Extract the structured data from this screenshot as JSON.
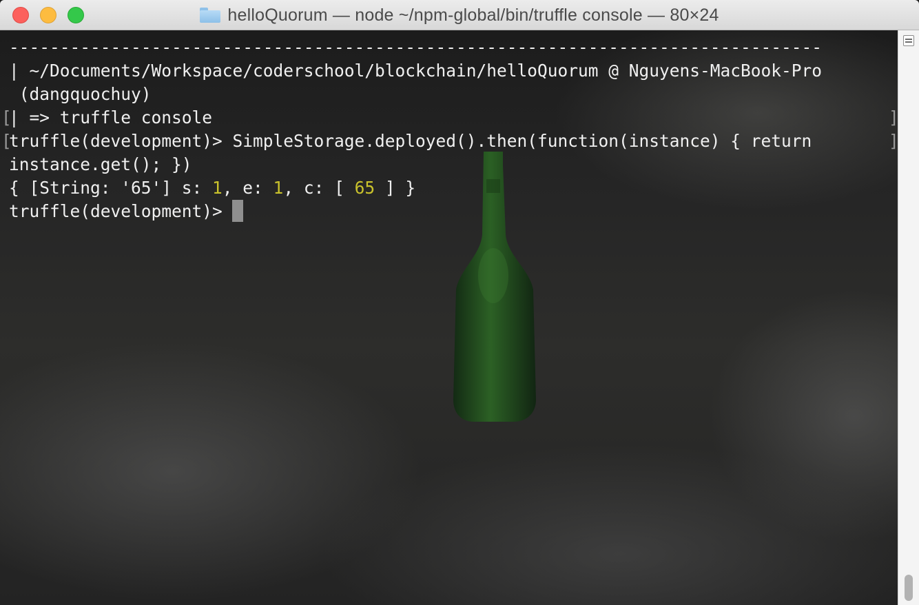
{
  "window": {
    "title": "helloQuorum — node ~/npm-global/bin/truffle console — 80×24"
  },
  "terminal": {
    "dash_line": "--------------------------------------------------------------------------------",
    "path_line": "| ~/Documents/Workspace/coderschool/blockchain/helloQuorum @ Nguyens-MacBook-Pro",
    "user_line": " (dangquochuy)",
    "command_line": "| => truffle console",
    "prompt_call_line": "truffle(development)> SimpleStorage.deployed().then(function(instance) { return",
    "call_continuation": "instance.get(); })",
    "result": {
      "prefix": "{ [String: '65'] s: ",
      "s_value": "1",
      "mid1": ", e: ",
      "e_value": "1",
      "mid2": ", c: [ ",
      "c_value": "65",
      "suffix": " ] }"
    },
    "prompt": "truffle(development)>",
    "bracket_left": "[",
    "bracket_right": "]"
  },
  "colors": {
    "number": "#c9c22c",
    "text": "#f0f0f0"
  },
  "icons": {
    "folder": "folder-icon",
    "scroll_toggle": "scrollbar-toggle-icon"
  }
}
